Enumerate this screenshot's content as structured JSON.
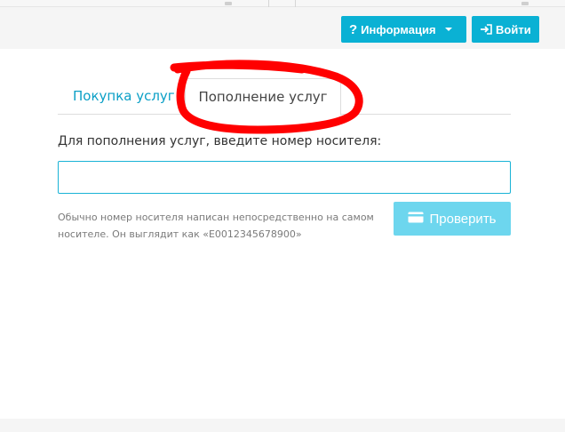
{
  "header": {
    "info_button_label": "Информация",
    "info_icon": "question-icon",
    "login_button_label": "Войти",
    "login_icon": "login-icon"
  },
  "tabs": [
    {
      "label": "Покупка услуг",
      "active": false
    },
    {
      "label": "Пополнение услуг",
      "active": true
    }
  ],
  "form": {
    "label": "Для пополнения услуг, введите номер носителя:",
    "input_value": "",
    "input_placeholder": "",
    "hint": "Обычно номер носителя написан непосредственно на самом носителе. Он выглядит как «E0012345678900»",
    "check_button_label": "Проверить",
    "check_icon": "card-icon"
  },
  "colors": {
    "accent": "#0ab1d4",
    "accent_disabled": "#6dd6ee",
    "tab_link": "#0a9fc6",
    "annotation": "#ff0000"
  }
}
